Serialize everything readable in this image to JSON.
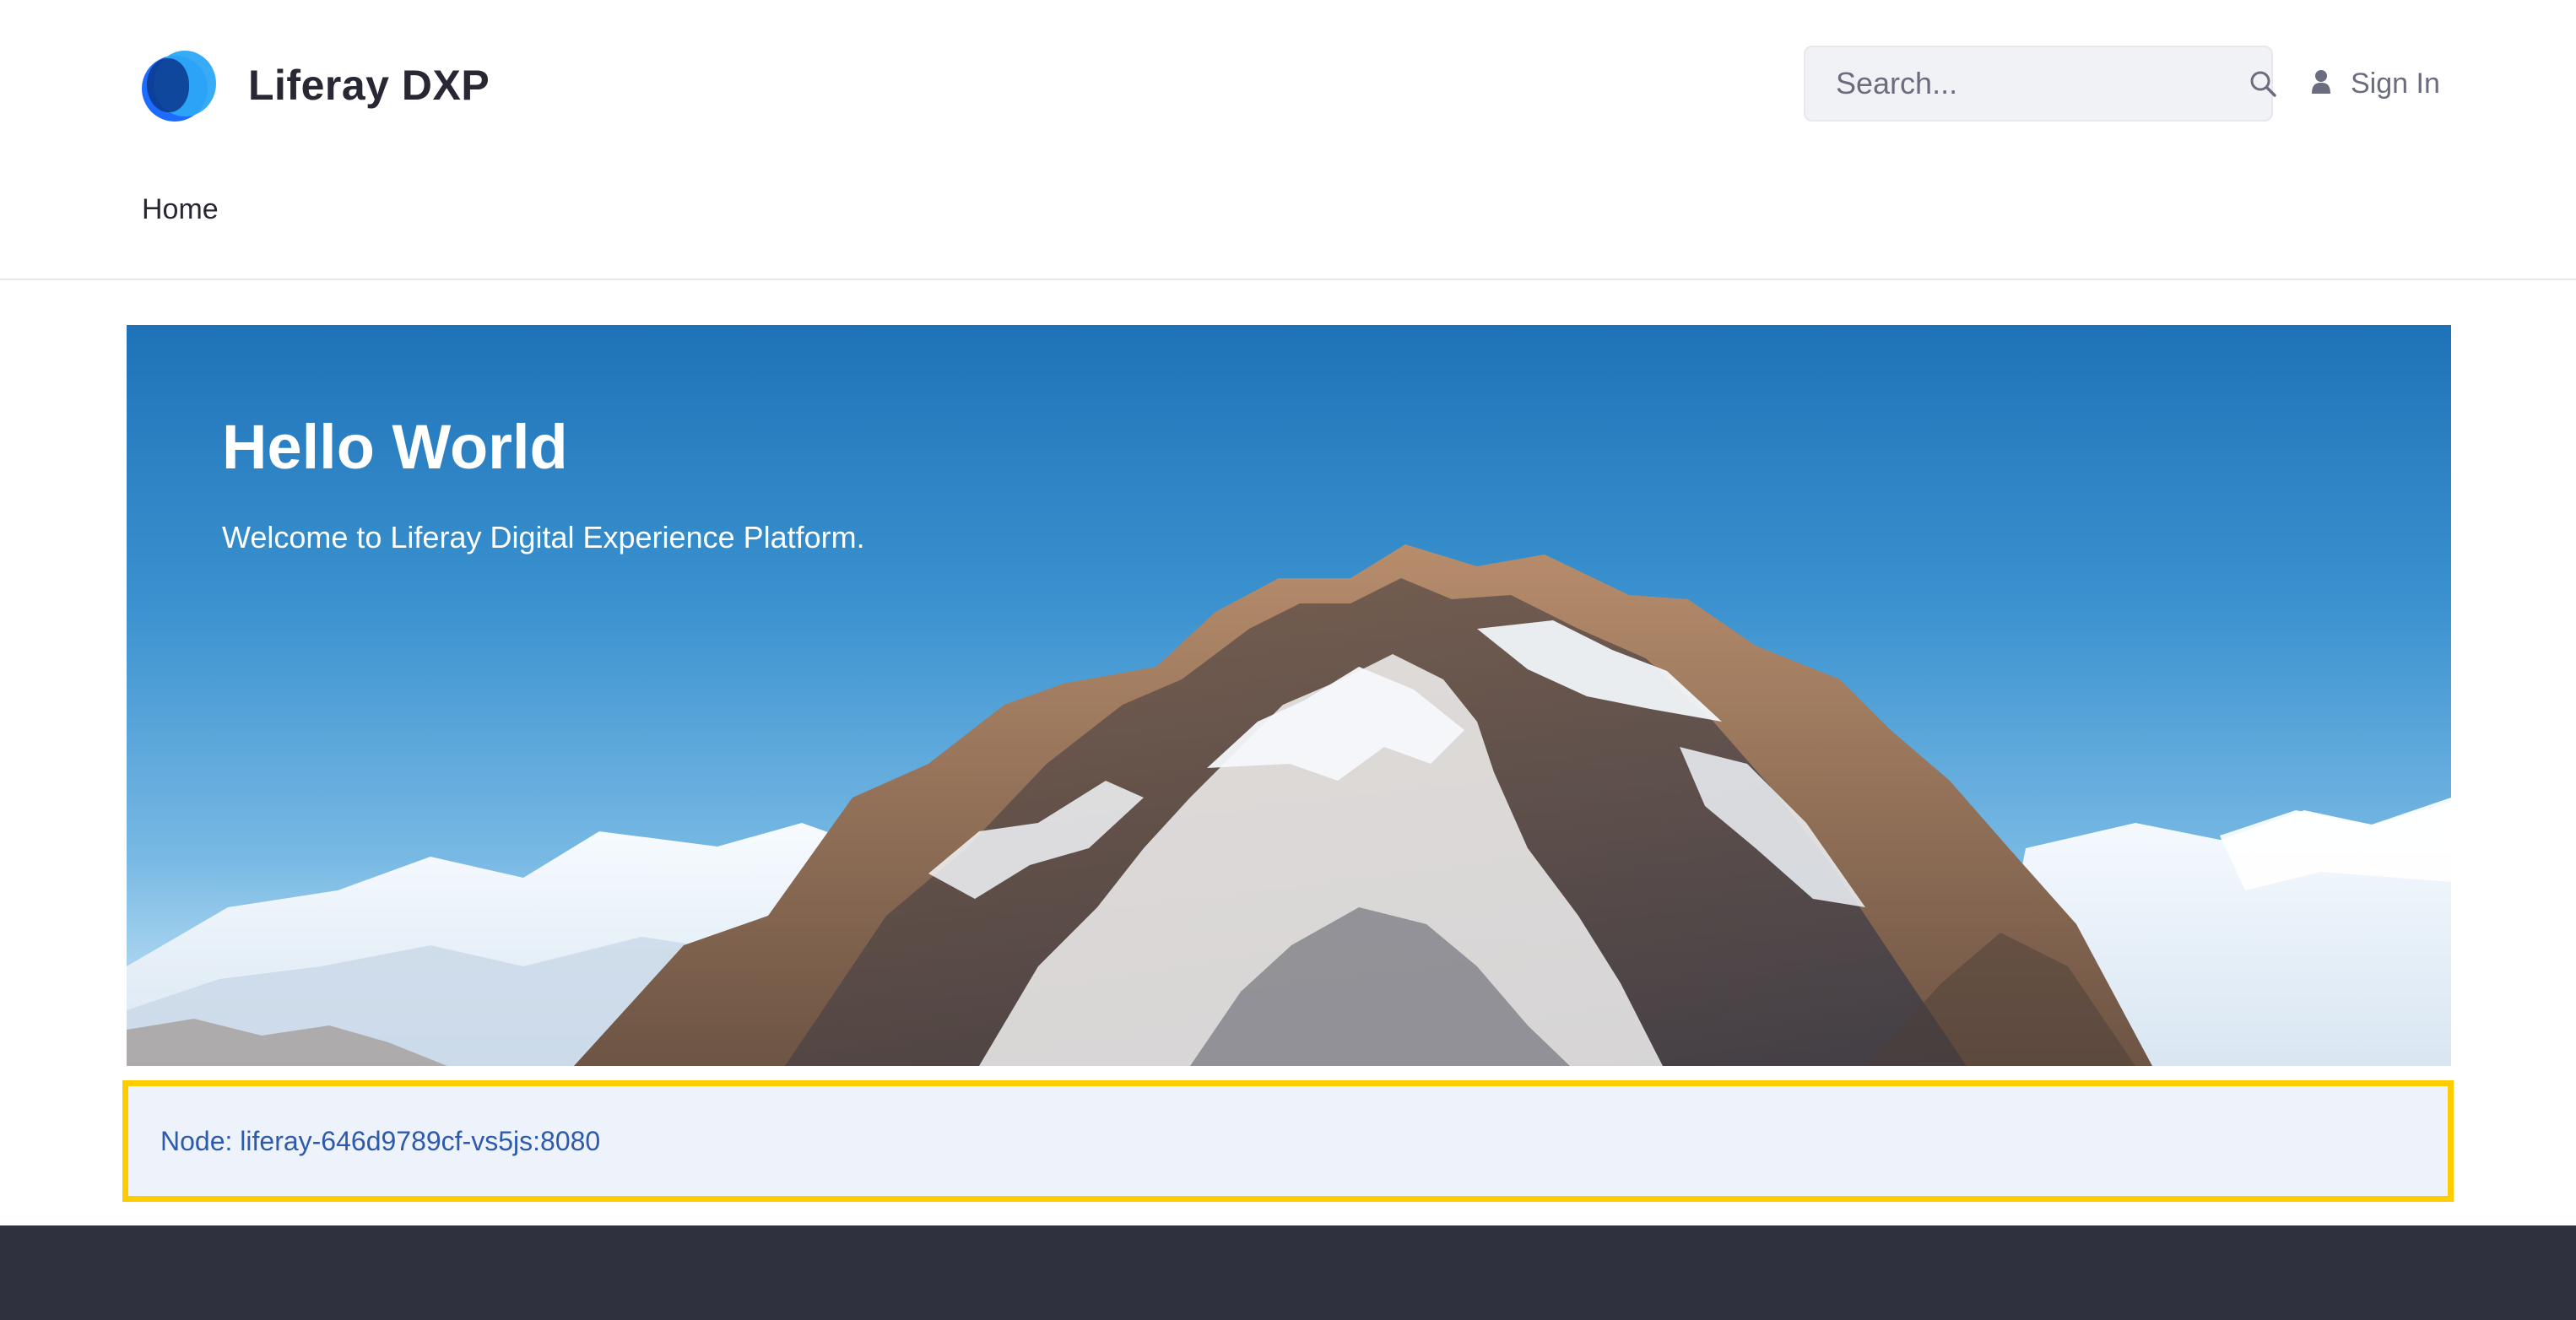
{
  "header": {
    "brand_name": "Liferay DXP",
    "search": {
      "placeholder": "Search...",
      "value": ""
    },
    "sign_in_label": "Sign In",
    "nav": [
      {
        "label": "Home"
      }
    ]
  },
  "hero": {
    "title": "Hello World",
    "subtitle": "Welcome to Liferay Digital Experience Platform."
  },
  "node_info": {
    "label": "Node: liferay-646d9789cf-vs5js:8080"
  },
  "colors": {
    "accent": "#0b5fff",
    "highlight_border": "#ffcc00",
    "footer": "#30313f",
    "text_primary": "#272833",
    "text_secondary": "#6b6c7e"
  },
  "icons": {
    "logo": "liferay-logo-icon",
    "search": "search-icon",
    "user": "user-icon"
  }
}
